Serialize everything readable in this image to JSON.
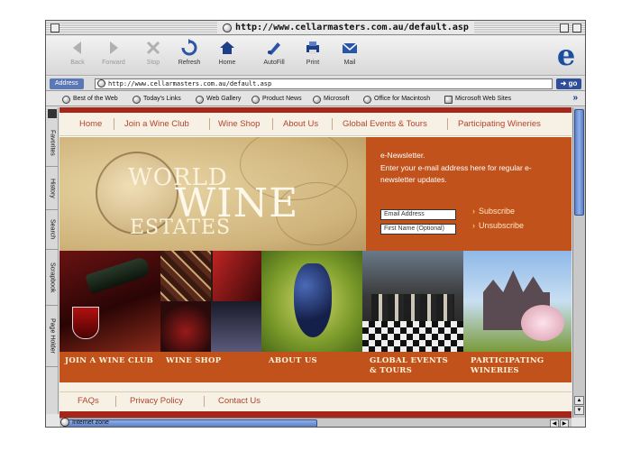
{
  "window": {
    "title": "http://www.cellarmasters.com.au/default.asp"
  },
  "toolbar": {
    "buttons": [
      {
        "label": "Back",
        "icon": "back-arrow-icon"
      },
      {
        "label": "Forward",
        "icon": "forward-arrow-icon"
      },
      {
        "label": "Stop",
        "icon": "stop-icon"
      },
      {
        "label": "Refresh",
        "icon": "refresh-icon"
      },
      {
        "label": "Home",
        "icon": "home-icon"
      },
      {
        "label": "AutoFill",
        "icon": "autofill-icon"
      },
      {
        "label": "Print",
        "icon": "print-icon"
      },
      {
        "label": "Mail",
        "icon": "mail-icon"
      }
    ],
    "logo": "e"
  },
  "address": {
    "label": "Address",
    "url": "http://www.cellarmasters.com.au/default.asp",
    "go_label": "go"
  },
  "favorites": {
    "items": [
      "Best of the Web",
      "Today's Links",
      "Web Gallery",
      "Product News",
      "Microsoft",
      "Office for Macintosh",
      "Microsoft Web Sites"
    ],
    "more": "»"
  },
  "sidebar": {
    "tabs": [
      "Favorites",
      "History",
      "Search",
      "Scrapbook",
      "Page Holder"
    ]
  },
  "page": {
    "nav": [
      "Home",
      "Join a Wine Club",
      "Wine Shop",
      "About Us",
      "Global Events & Tours",
      "Participating Wineries"
    ],
    "hero": {
      "line1": "WORLD",
      "line2": "WINE",
      "line3": "ESTATES"
    },
    "newsletter": {
      "title": "e-Newsletter.",
      "description": "Enter your e-mail address here for regular e-newsletter updates.",
      "email_placeholder": "Email Address",
      "name_placeholder": "First Name (Optional)",
      "subscribe": "Subscribe",
      "unsubscribe": "Unsubscribe"
    },
    "captions": [
      "JOIN A WINE CLUB",
      "WINE SHOP",
      "ABOUT US",
      "GLOBAL EVENTS",
      "& TOURS",
      "PARTICIPATING",
      "WINERIES"
    ],
    "footer_nav": [
      "FAQs",
      "Privacy Policy",
      "Contact Us"
    ]
  },
  "status": {
    "text": "Internet zone"
  },
  "colors": {
    "brand_orange": "#c2521c",
    "brand_red": "#a7261a",
    "link": "#b5442e",
    "cream": "#f6f1e4"
  }
}
